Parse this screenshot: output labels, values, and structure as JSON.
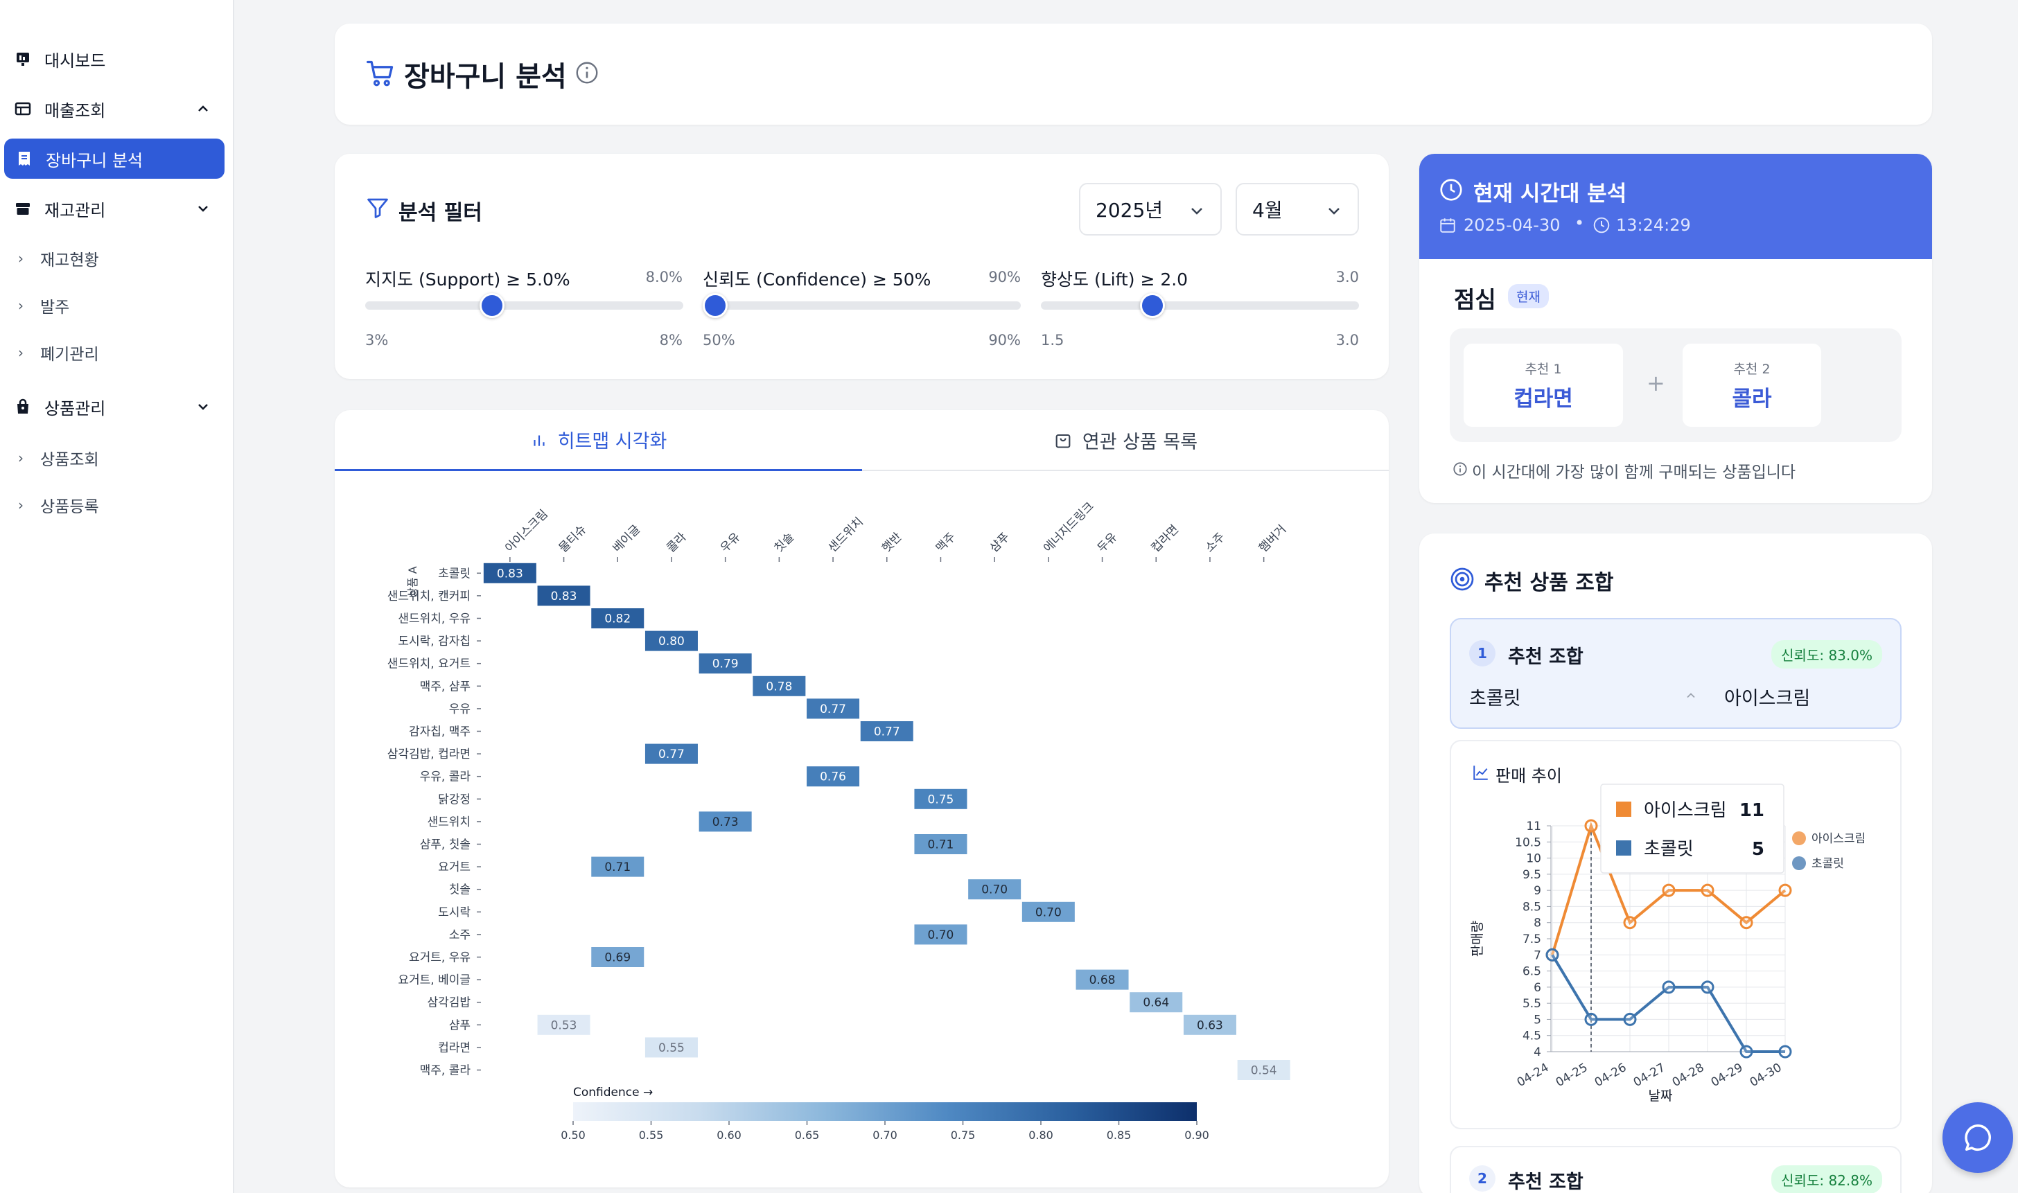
{
  "sidebar": {
    "items": [
      {
        "label": "대시보드"
      },
      {
        "label": "매출조회"
      },
      {
        "label": "장바구니 분석"
      },
      {
        "label": "재고관리"
      },
      {
        "label": "재고현황"
      },
      {
        "label": "발주"
      },
      {
        "label": "폐기관리"
      },
      {
        "label": "상품관리"
      },
      {
        "label": "상품조회"
      },
      {
        "label": "상품등록"
      }
    ]
  },
  "page": {
    "title": "장바구니 분석"
  },
  "filter": {
    "title": "분석 필터",
    "year": "2025년",
    "month": "4월",
    "sliders": [
      {
        "label": "지지도 (Support) ≥ 5.0%",
        "max_label": "8.0%",
        "min_tick": "3%",
        "max_tick": "8%",
        "value_fraction": 0.4
      },
      {
        "label": "신뢰도 (Confidence) ≥ 50%",
        "max_label": "90%",
        "min_tick": "50%",
        "max_tick": "90%",
        "value_fraction": 0.0
      },
      {
        "label": "향상도 (Lift) ≥ 2.0",
        "max_label": "3.0",
        "min_tick": "1.5",
        "max_tick": "3.0",
        "value_fraction": 0.333
      }
    ]
  },
  "tabs": {
    "heatmap": "히트맵 시각화",
    "list": "연관 상품 목록"
  },
  "heatmap": {
    "y_axis_label": "상품 A",
    "colorbar_title": "Confidence →",
    "colorbar_ticks": [
      "0.50",
      "0.55",
      "0.60",
      "0.65",
      "0.70",
      "0.75",
      "0.80",
      "0.85",
      "0.90"
    ]
  },
  "chart_data": [
    {
      "type": "heatmap",
      "x_categories": [
        "아이스크림",
        "물티슈",
        "베이글",
        "콜라",
        "우유",
        "칫솔",
        "샌드위치",
        "햇반",
        "맥주",
        "샴푸",
        "에너지드링크",
        "두유",
        "컵라면",
        "소주",
        "햄버거"
      ],
      "y_categories": [
        "초콜릿",
        "샌드위치, 캔커피",
        "샌드위치, 우유",
        "도시락, 감자칩",
        "샌드위치, 요거트",
        "맥주, 샴푸",
        "우유",
        "감자칩, 맥주",
        "삼각김밥, 컵라면",
        "우유, 콜라",
        "닭강정",
        "샌드위치",
        "샴푸, 칫솔",
        "요거트",
        "칫솔",
        "도시락",
        "소주",
        "요거트, 우유",
        "요거트, 베이글",
        "삼각김밥",
        "샴푸",
        "컵라면",
        "맥주, 콜라"
      ],
      "cells": [
        {
          "y": "초콜릿",
          "x": "아이스크림",
          "value": "0.83"
        },
        {
          "y": "샌드위치, 캔커피",
          "x": "물티슈",
          "value": "0.83"
        },
        {
          "y": "샌드위치, 우유",
          "x": "베이글",
          "value": "0.82"
        },
        {
          "y": "도시락, 감자칩",
          "x": "콜라",
          "value": "0.80"
        },
        {
          "y": "샌드위치, 요거트",
          "x": "우유",
          "value": "0.79"
        },
        {
          "y": "맥주, 샴푸",
          "x": "칫솔",
          "value": "0.78"
        },
        {
          "y": "우유",
          "x": "샌드위치",
          "value": "0.77"
        },
        {
          "y": "감자칩, 맥주",
          "x": "햇반",
          "value": "0.77"
        },
        {
          "y": "삼각김밥, 컵라면",
          "x": "콜라",
          "value": "0.77"
        },
        {
          "y": "우유, 콜라",
          "x": "샌드위치",
          "value": "0.76"
        },
        {
          "y": "닭강정",
          "x": "맥주",
          "value": "0.75"
        },
        {
          "y": "샌드위치",
          "x": "우유",
          "value": "0.73"
        },
        {
          "y": "샴푸, 칫솔",
          "x": "맥주",
          "value": "0.71"
        },
        {
          "y": "요거트",
          "x": "베이글",
          "value": "0.71"
        },
        {
          "y": "칫솔",
          "x": "샴푸",
          "value": "0.70"
        },
        {
          "y": "도시락",
          "x": "에너지드링크",
          "value": "0.70"
        },
        {
          "y": "소주",
          "x": "맥주",
          "value": "0.70"
        },
        {
          "y": "요거트, 우유",
          "x": "베이글",
          "value": "0.69"
        },
        {
          "y": "요거트, 베이글",
          "x": "두유",
          "value": "0.68"
        },
        {
          "y": "삼각김밥",
          "x": "컵라면",
          "value": "0.64"
        },
        {
          "y": "샴푸",
          "x": "소주",
          "value": "0.63"
        },
        {
          "y": "샴푸",
          "x": "물티슈",
          "value": "0.53"
        },
        {
          "y": "컵라면",
          "x": "콜라",
          "value": "0.55"
        },
        {
          "y": "맥주, 콜라",
          "x": "햄버거",
          "value": "0.54"
        }
      ],
      "colorscale": [
        "#eef3fa",
        "#c9dcee",
        "#8db8dc",
        "#4f89c3",
        "#2a5f9e",
        "#0d2f6b"
      ],
      "zmin": 0.5,
      "zmax": 0.9
    },
    {
      "type": "line",
      "x": [
        "04-24",
        "04-25",
        "04-26",
        "04-27",
        "04-28",
        "04-29",
        "04-30"
      ],
      "series": [
        {
          "name": "아이스크림",
          "color": "#ef8a34",
          "values": [
            7,
            11,
            8,
            9,
            9,
            8,
            9
          ]
        },
        {
          "name": "초콜릿",
          "color": "#3d74ad",
          "values": [
            7,
            5,
            5,
            6,
            6,
            4,
            4
          ]
        }
      ],
      "y_ticks": [
        "4",
        "4.5",
        "5",
        "5.5",
        "6",
        "6.5",
        "7",
        "7.5",
        "8",
        "8.5",
        "9",
        "9.5",
        "10",
        "10.5",
        "11"
      ],
      "ylim": [
        4,
        11
      ],
      "xlabel": "날짜",
      "ylabel": "판매량",
      "tooltip": {
        "x": "04-25",
        "rows": [
          {
            "name": "아이스크림",
            "value": "11"
          },
          {
            "name": "초콜릿",
            "value": "5"
          }
        ]
      }
    }
  ],
  "time_analysis": {
    "title": "현재 시간대 분석",
    "date": "2025-04-30",
    "time": "13:24:29",
    "period": "점심",
    "badge": "현재",
    "rec1_label": "추천 1",
    "rec1_value": "컵라면",
    "rec2_label": "추천 2",
    "rec2_value": "콜라",
    "note": "이 시간대에 가장 많이 함께 구매되는 상품입니다"
  },
  "recommend": {
    "title": "추천 상품 조합",
    "combo1": {
      "num": "1",
      "title": "추천 조합",
      "confidence": "신뢰도: 83.0%",
      "from": "초콜릿",
      "to": "아이스크림"
    },
    "trend_title": "판매 추이",
    "combo2": {
      "num": "2",
      "title": "추천 조합",
      "confidence": "신뢰도: 82.8%"
    }
  },
  "colors": {
    "accent": "#2f5bd8",
    "header": "#4d6ee6"
  }
}
